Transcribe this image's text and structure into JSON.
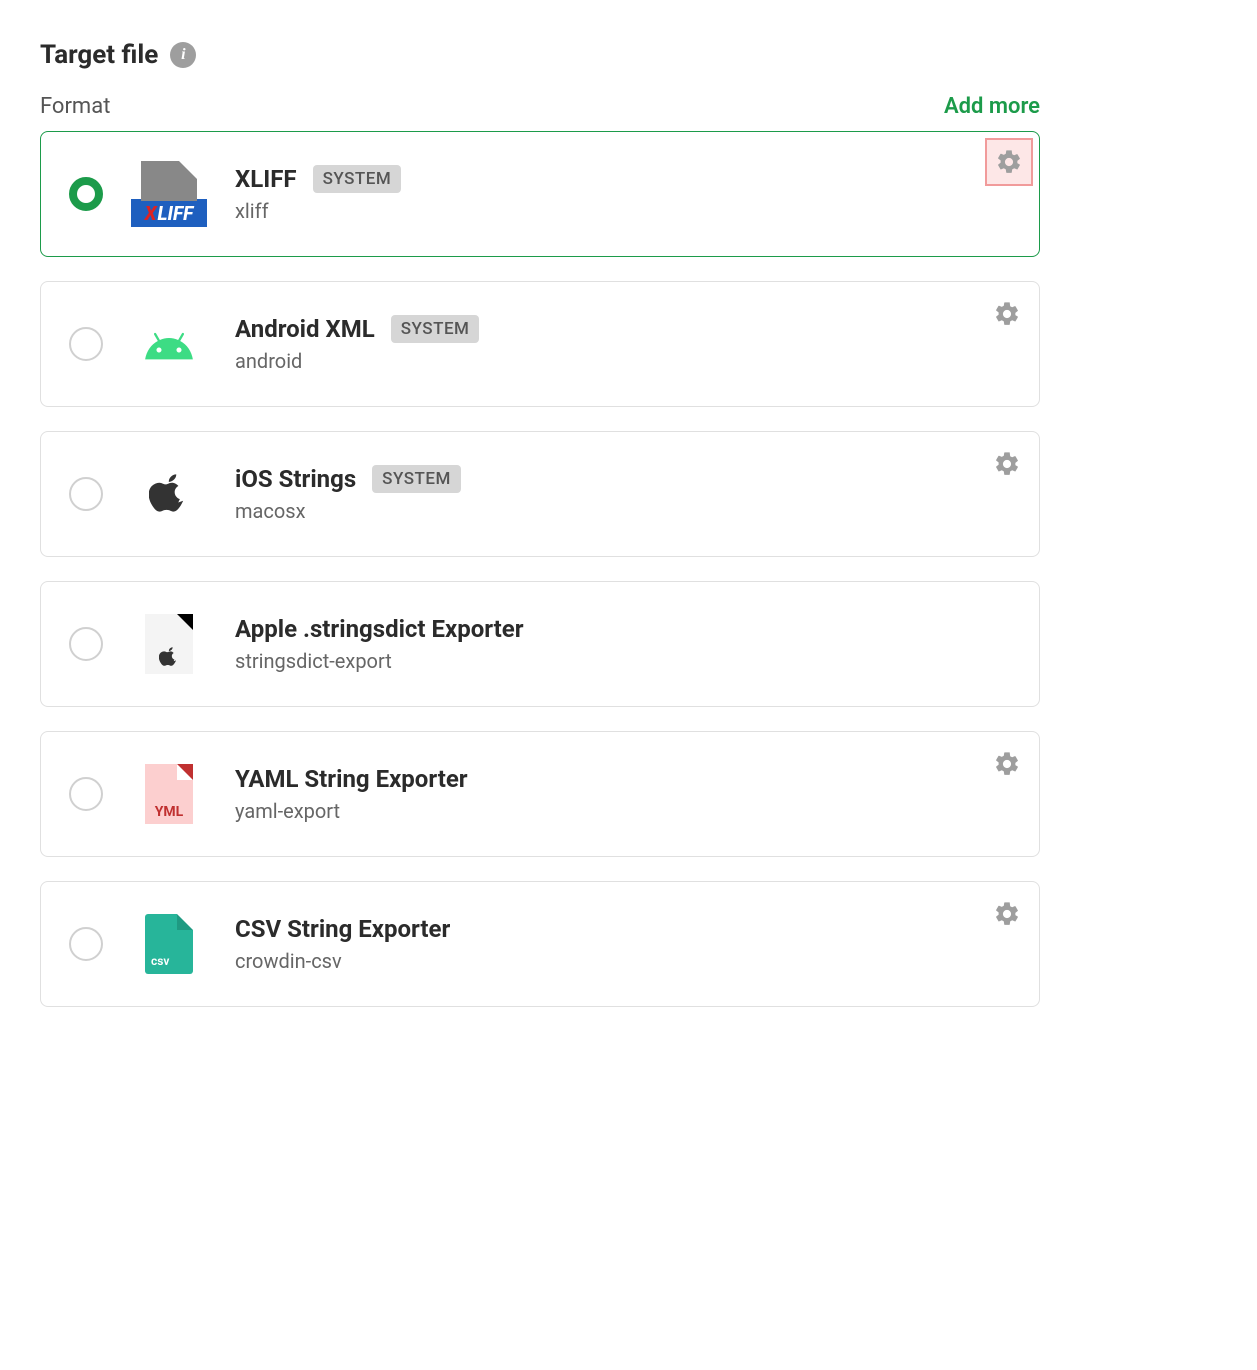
{
  "header": {
    "title": "Target file"
  },
  "section": {
    "label": "Format",
    "add_more": "Add more"
  },
  "badge_system": "SYSTEM",
  "formats": [
    {
      "selected": true,
      "gear_highlight": true,
      "show_gear": true,
      "icon": "xliff",
      "title": "XLIFF",
      "system": true,
      "subtitle": "xliff"
    },
    {
      "selected": false,
      "gear_highlight": false,
      "show_gear": true,
      "icon": "android",
      "title": "Android XML",
      "system": true,
      "subtitle": "android"
    },
    {
      "selected": false,
      "gear_highlight": false,
      "show_gear": true,
      "icon": "ios",
      "title": "iOS Strings",
      "system": true,
      "subtitle": "macosx"
    },
    {
      "selected": false,
      "gear_highlight": false,
      "show_gear": false,
      "icon": "stringsdict",
      "title": "Apple .stringsdict Exporter",
      "system": false,
      "subtitle": "stringsdict-export"
    },
    {
      "selected": false,
      "gear_highlight": false,
      "show_gear": true,
      "icon": "yaml",
      "title": "YAML String Exporter",
      "system": false,
      "subtitle": "yaml-export",
      "icon_label": "YML"
    },
    {
      "selected": false,
      "gear_highlight": false,
      "show_gear": true,
      "icon": "csv",
      "title": "CSV String Exporter",
      "system": false,
      "subtitle": "crowdin-csv",
      "icon_label": "csv"
    }
  ]
}
